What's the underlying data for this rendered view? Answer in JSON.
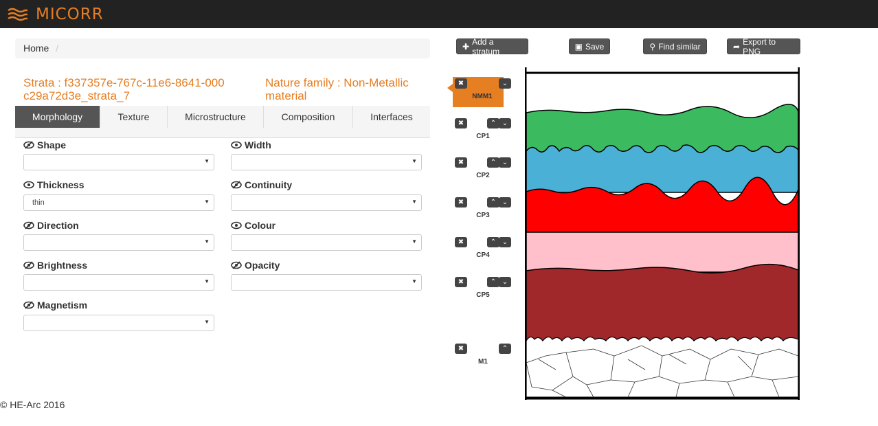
{
  "app": {
    "brand": "MICORR"
  },
  "breadcrumb": {
    "home": "Home",
    "separator": "/"
  },
  "strata": {
    "title": "Strata : f337357e-767c-11e6-8641-000c29a72d3e_strata_7",
    "nature": "Nature family : Non-Metallic material"
  },
  "tabs": [
    {
      "label": "Morphology",
      "active": true
    },
    {
      "label": "Texture"
    },
    {
      "label": "Microstructure"
    },
    {
      "label": "Composition"
    },
    {
      "label": "Interfaces"
    }
  ],
  "fields": {
    "shape": {
      "label": "Shape",
      "value": "",
      "icon": "eye-slash-icon"
    },
    "width": {
      "label": "Width",
      "value": "",
      "icon": "eye-icon"
    },
    "thickness": {
      "label": "Thickness",
      "value": "thin",
      "icon": "eye-icon"
    },
    "continuity": {
      "label": "Continuity",
      "value": "",
      "icon": "eye-slash-icon"
    },
    "direction": {
      "label": "Direction",
      "value": "",
      "icon": "eye-slash-icon"
    },
    "colour": {
      "label": "Colour",
      "value": "",
      "icon": "eye-icon"
    },
    "brightness": {
      "label": "Brightness",
      "value": "",
      "icon": "eye-slash-icon"
    },
    "opacity": {
      "label": "Opacity",
      "value": "",
      "icon": "eye-slash-icon"
    },
    "magnetism": {
      "label": "Magnetism",
      "value": "",
      "icon": "eye-slash-icon"
    }
  },
  "toolbar": {
    "add_stratum": "Add a stratum",
    "save": "Save",
    "find_similar": "Find similar",
    "export_png": "Export to PNG"
  },
  "strata_list": [
    {
      "label": "NMM1",
      "selected": true,
      "color": "#ffffff"
    },
    {
      "label": "CP1",
      "color": "#3cba60"
    },
    {
      "label": "CP2",
      "color": "#4ab0d6"
    },
    {
      "label": "CP3",
      "color": "#ff0000"
    },
    {
      "label": "CP4",
      "color": "#ffc0cb"
    },
    {
      "label": "CP5",
      "color": "#a0282a"
    },
    {
      "label": "M1",
      "color": "#ffffff"
    }
  ],
  "footer": {
    "text": "© HE-Arc 2016"
  },
  "colors": {
    "accent": "#e67e22",
    "navbar": "#222222",
    "button": "#555555"
  }
}
